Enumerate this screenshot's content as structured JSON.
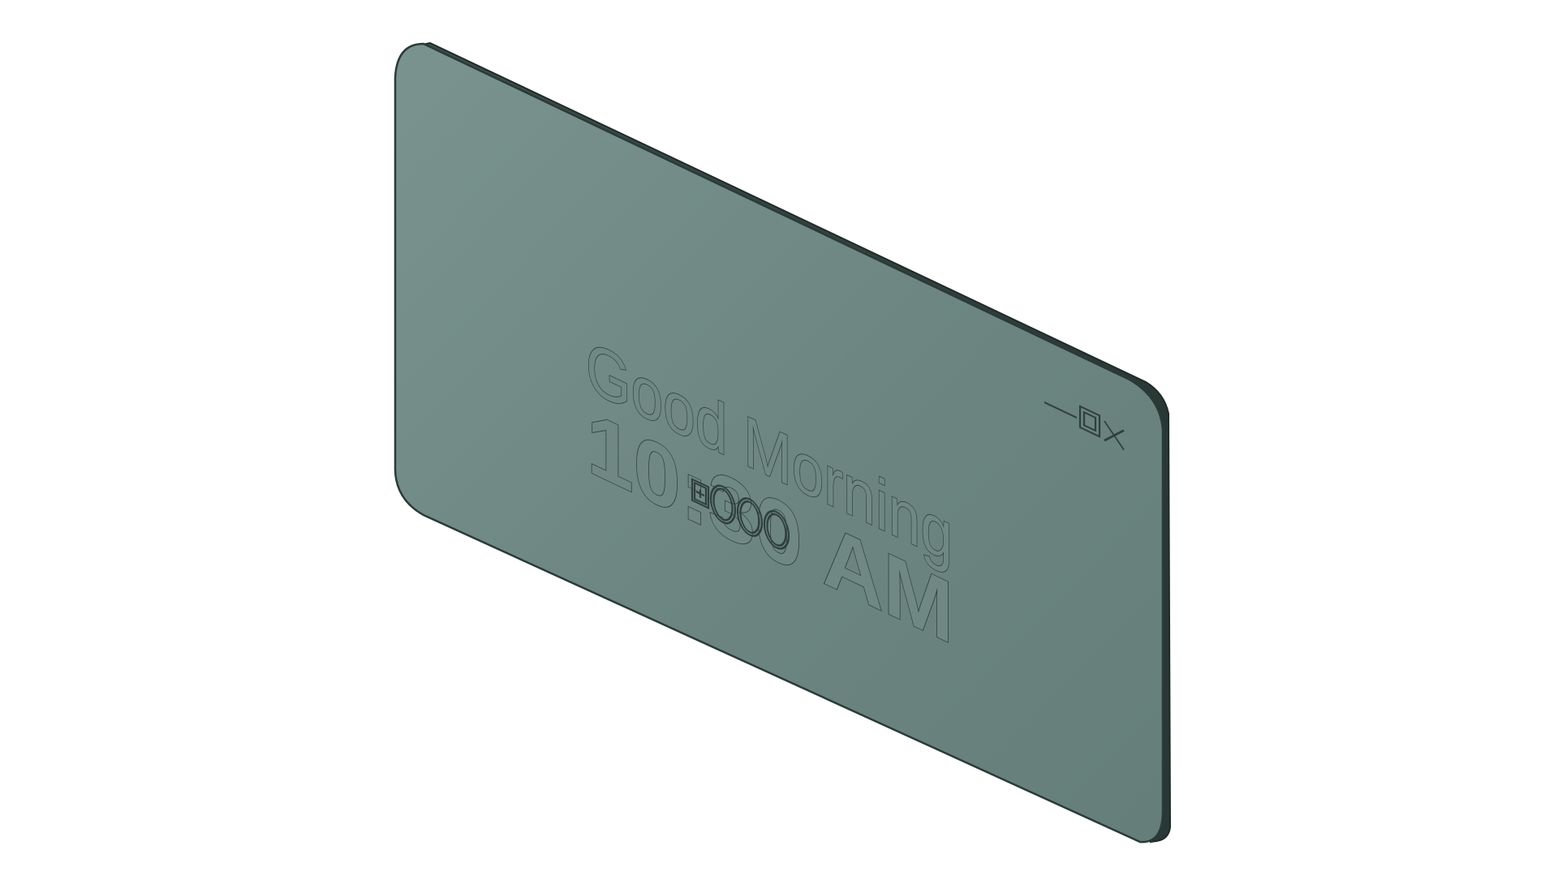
{
  "widget": {
    "greeting": "Good Morning",
    "time": "10:30 AM"
  },
  "window_controls": {
    "icons": [
      "minimize-icon",
      "maximize-icon",
      "close-icon"
    ]
  },
  "page_indicator": {
    "icons": [
      "add-page-icon",
      "page-dot-icon",
      "page-dot-icon",
      "page-dot-icon"
    ]
  },
  "colors": {
    "panel_face": "#6f8884",
    "panel_edge": "#33443f",
    "text_outline": "#2f3f3d",
    "background": "#ffffff"
  }
}
